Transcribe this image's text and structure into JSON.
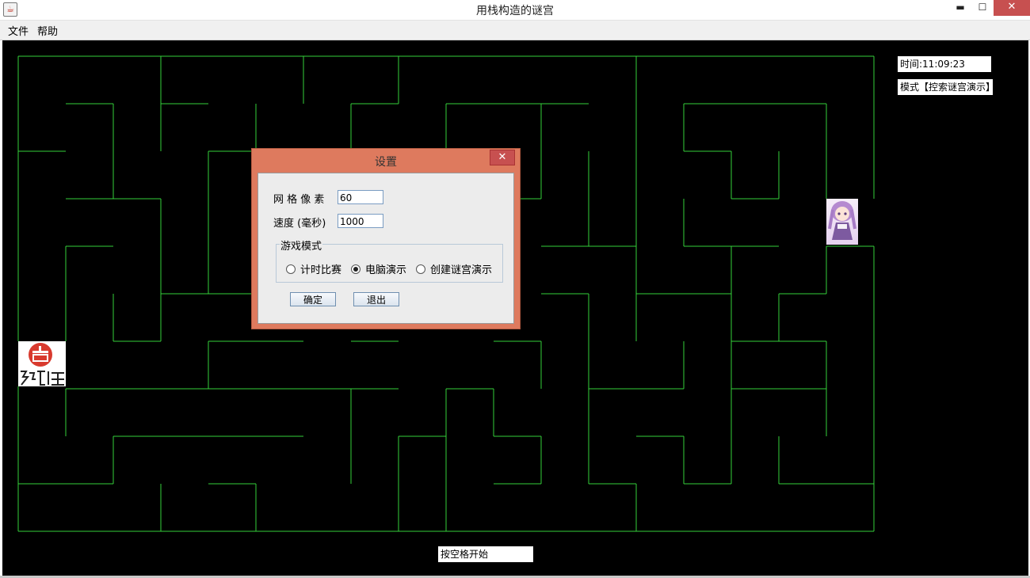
{
  "window": {
    "title": "用栈构造的谜宫",
    "app_icon": "java-cup-icon",
    "controls": {
      "minimize": "▬",
      "maximize": "☐",
      "close": "✕"
    }
  },
  "menu": {
    "file": "文件",
    "help": "帮助"
  },
  "game": {
    "time_label": "时间:11:09:23",
    "mode_label": "模式【控索谜宫演示】",
    "start_hint": "按空格开始",
    "wall_color": "#35d13a",
    "background_color": "#000000"
  },
  "dialog": {
    "title": "设置",
    "close": "✕",
    "grid_pixel_label": "网 格 像 素",
    "grid_pixel_value": "60",
    "speed_label": "速度 (毫秒)",
    "speed_value": "1000",
    "mode_group": "游戏模式",
    "modes": [
      "计时比赛",
      "电脑演示",
      "创建谜宫演示"
    ],
    "selected_mode": "电脑演示",
    "ok": "确定",
    "exit": "退出"
  }
}
